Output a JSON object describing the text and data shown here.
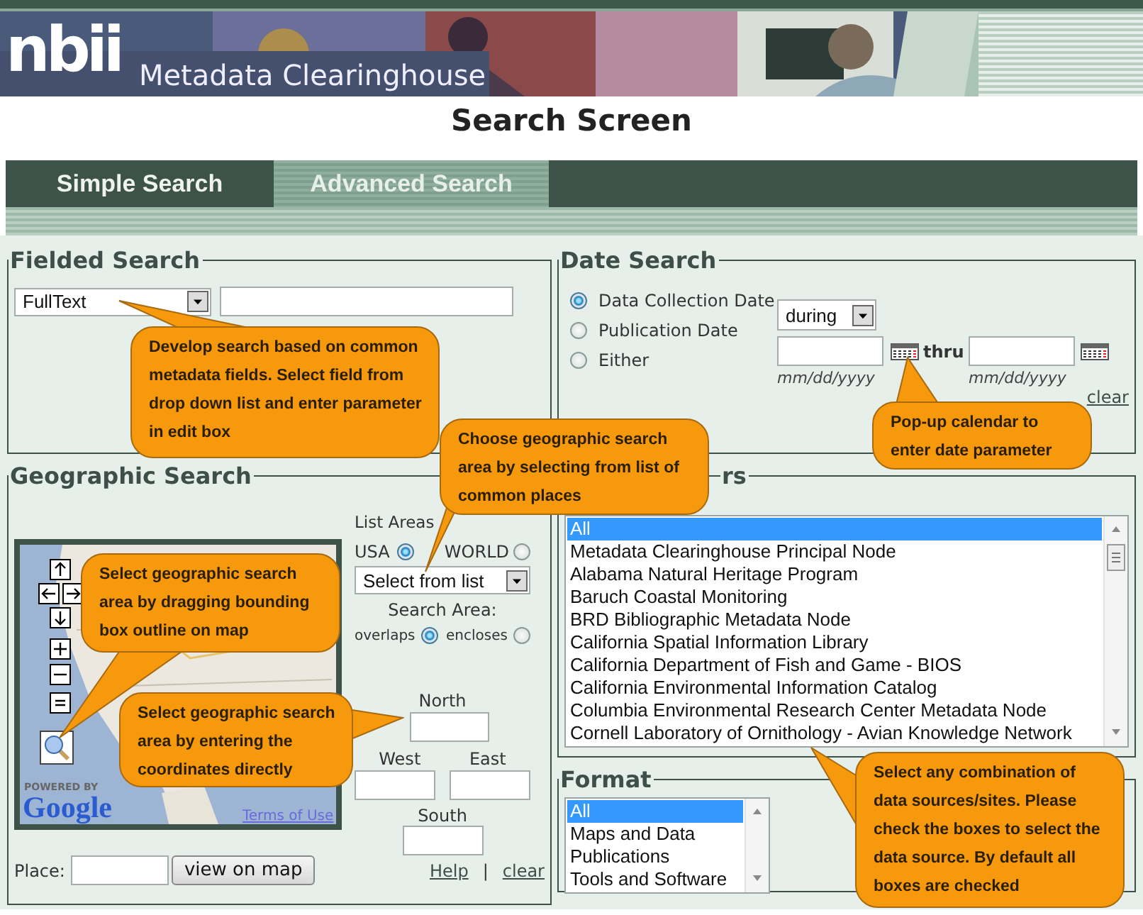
{
  "header": {
    "logo": "nbii",
    "site_name": "Metadata Clearinghouse"
  },
  "page_title": "Search Screen",
  "tabs": [
    {
      "label": "Simple Search",
      "selected": false
    },
    {
      "label": "Advanced Search",
      "selected": true
    }
  ],
  "fielded_search": {
    "title": "Fielded Search",
    "field_select": "FullText"
  },
  "date_search": {
    "title": "Date Search",
    "options": [
      {
        "label": "Data Collection Date",
        "selected": true
      },
      {
        "label": "Publication Date",
        "selected": false
      },
      {
        "label": "Either",
        "selected": false
      }
    ],
    "range_select": "during",
    "thru_label": "thru",
    "from_hint": "mm/dd/yyyy",
    "to_hint": "mm/dd/yyyy",
    "clear_link": "clear"
  },
  "geographic_search": {
    "title": "Geographic Search",
    "map": {
      "kind": "picture",
      "powered_by": "POWERED BY",
      "logo": "Google",
      "terms_link": "Terms of Use"
    },
    "list_areas_label": "List Areas",
    "area_options": [
      {
        "label": "USA",
        "selected": true
      },
      {
        "label": "WORLD",
        "selected": false
      }
    ],
    "area_select": "Select from list",
    "search_area_label": "Search Area:",
    "match_options": [
      {
        "label": "overlaps",
        "selected": true
      },
      {
        "label": "encloses",
        "selected": false
      }
    ],
    "north_label": "North",
    "west_label": "West",
    "east_label": "East",
    "south_label": "South",
    "place_label": "Place:",
    "view_button": "view on map",
    "help_link": "Help",
    "separator": "|",
    "clear_link": "clear"
  },
  "servers": {
    "title": "rs",
    "items": [
      {
        "label": "All",
        "selected": true
      },
      {
        "label": "Metadata Clearinghouse Principal Node",
        "selected": false
      },
      {
        "label": "Alabama Natural Heritage Program",
        "selected": false
      },
      {
        "label": "Baruch Coastal Monitoring",
        "selected": false
      },
      {
        "label": "BRD Bibliographic Metadata Node",
        "selected": false
      },
      {
        "label": "California Spatial Information Library",
        "selected": false
      },
      {
        "label": "California Department of Fish and Game - BIOS",
        "selected": false
      },
      {
        "label": "California Environmental Information Catalog",
        "selected": false
      },
      {
        "label": "Columbia Environmental Research Center Metadata Node",
        "selected": false
      },
      {
        "label": "Cornell Laboratory of Ornithology - Avian Knowledge Network",
        "selected": false
      }
    ]
  },
  "format": {
    "title": "Format",
    "items": [
      {
        "label": "All",
        "selected": true
      },
      {
        "label": "Maps and Data",
        "selected": false
      },
      {
        "label": "Publications",
        "selected": false
      },
      {
        "label": "Tools and Software",
        "selected": false
      }
    ]
  },
  "callouts": [
    {
      "text": "Develop search based on common metadata fields. Select field from drop down list and enter parameter in edit box"
    },
    {
      "text": "Pop-up calendar to enter date parameter"
    },
    {
      "text": "Choose geographic search area by selecting from list of common places"
    },
    {
      "text": "Select geographic search area by dragging bounding box outline on map"
    },
    {
      "text": "Select geographic search area by entering the coordinates directly"
    },
    {
      "text": "Select any combination of data sources/sites. Please check the boxes to select the data source. By default all boxes are checked"
    }
  ]
}
